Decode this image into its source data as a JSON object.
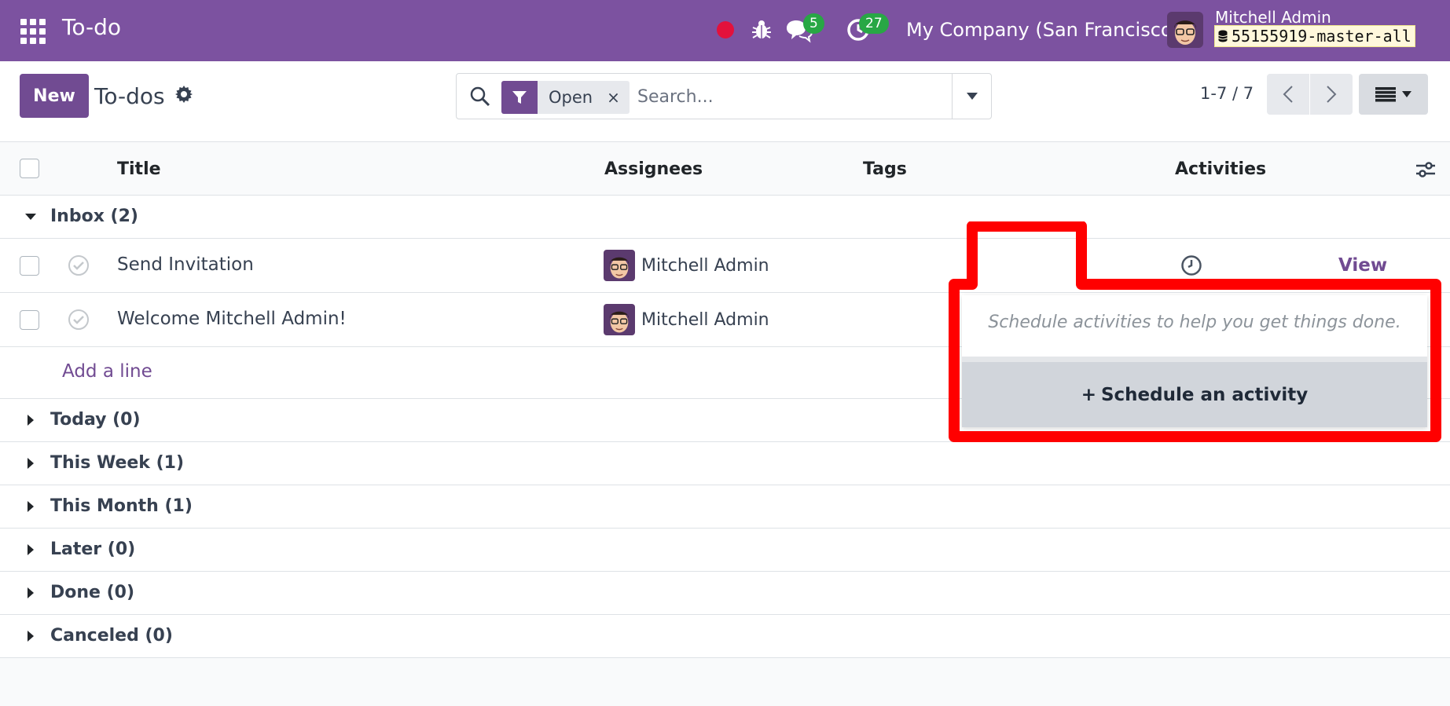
{
  "navbar": {
    "app_name": "To-do",
    "messages_count": "5",
    "activities_count": "27",
    "company": "My Company (San Francisco)",
    "user_name": "Mitchell Admin",
    "database": "55155919-master-all",
    "color": "#7c52a0"
  },
  "control_panel": {
    "new_label": "New",
    "breadcrumb": "To-dos",
    "search": {
      "facet_label": "Open",
      "facet_remove": "×",
      "placeholder": "Search..."
    },
    "pager": "1-7 / 7"
  },
  "list": {
    "columns": {
      "title": "Title",
      "assignees": "Assignees",
      "tags": "Tags",
      "activities": "Activities"
    },
    "groups": [
      {
        "label": "Inbox (2)",
        "expanded": true
      },
      {
        "label": "Today (0)",
        "expanded": false
      },
      {
        "label": "This Week (1)",
        "expanded": false
      },
      {
        "label": "This Month (1)",
        "expanded": false
      },
      {
        "label": "Later (0)",
        "expanded": false
      },
      {
        "label": "Done (0)",
        "expanded": false
      },
      {
        "label": "Canceled (0)",
        "expanded": false
      }
    ],
    "rows": [
      {
        "title": "Send Invitation",
        "assignee": "Mitchell Admin",
        "action": "View"
      },
      {
        "title": "Welcome Mitchell Admin!",
        "assignee": "Mitchell Admin"
      }
    ],
    "add_line": "Add a line"
  },
  "activity_popover": {
    "hint": "Schedule activities to help you get things done.",
    "button_icon": "+",
    "button_label": "Schedule an activity"
  },
  "colors": {
    "accent": "#714b92",
    "badge": "#28a745",
    "highlight": "#ff0000"
  }
}
